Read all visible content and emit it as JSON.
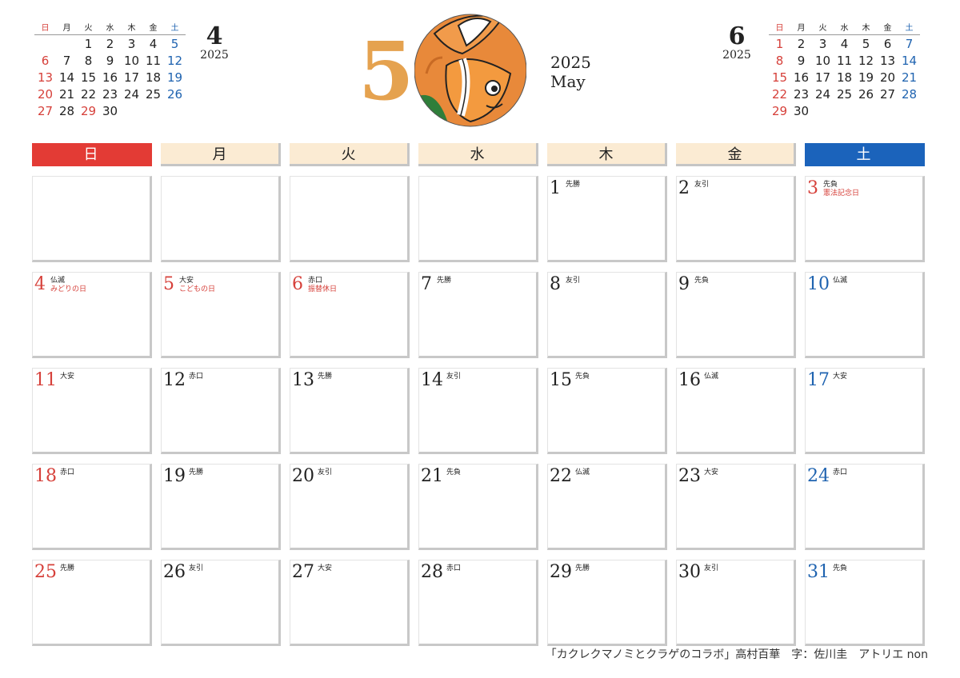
{
  "weekday_labels": [
    "日",
    "月",
    "火",
    "水",
    "木",
    "金",
    "土"
  ],
  "prev_month": {
    "month": "4",
    "year": "2025",
    "days": [
      "",
      "",
      "1",
      "2",
      "3",
      "4",
      "5",
      "6",
      "7",
      "8",
      "9",
      "10",
      "11",
      "12",
      "13",
      "14",
      "15",
      "16",
      "17",
      "18",
      "19",
      "20",
      "21",
      "22",
      "23",
      "24",
      "25",
      "26",
      "27",
      "28",
      "29",
      "30",
      "",
      "",
      ""
    ],
    "holidays": [
      "29"
    ]
  },
  "next_month": {
    "month": "6",
    "year": "2025",
    "days": [
      "1",
      "2",
      "3",
      "4",
      "5",
      "6",
      "7",
      "8",
      "9",
      "10",
      "11",
      "12",
      "13",
      "14",
      "15",
      "16",
      "17",
      "18",
      "19",
      "20",
      "21",
      "22",
      "23",
      "24",
      "25",
      "26",
      "27",
      "28",
      "29",
      "30",
      "",
      "",
      "",
      "",
      ""
    ],
    "holidays": []
  },
  "current": {
    "month_number": "5",
    "year": "2025",
    "month_name": "May"
  },
  "days": [
    {
      "num": "",
      "rokuyo": "",
      "holiday": ""
    },
    {
      "num": "",
      "rokuyo": "",
      "holiday": ""
    },
    {
      "num": "",
      "rokuyo": "",
      "holiday": ""
    },
    {
      "num": "",
      "rokuyo": "",
      "holiday": ""
    },
    {
      "num": "1",
      "rokuyo": "先勝",
      "holiday": ""
    },
    {
      "num": "2",
      "rokuyo": "友引",
      "holiday": ""
    },
    {
      "num": "3",
      "rokuyo": "先負",
      "holiday": "憲法記念日"
    },
    {
      "num": "4",
      "rokuyo": "仏滅",
      "holiday": "みどりの日"
    },
    {
      "num": "5",
      "rokuyo": "大安",
      "holiday": "こどもの日"
    },
    {
      "num": "6",
      "rokuyo": "赤口",
      "holiday": "振替休日"
    },
    {
      "num": "7",
      "rokuyo": "先勝",
      "holiday": ""
    },
    {
      "num": "8",
      "rokuyo": "友引",
      "holiday": ""
    },
    {
      "num": "9",
      "rokuyo": "先負",
      "holiday": ""
    },
    {
      "num": "10",
      "rokuyo": "仏滅",
      "holiday": ""
    },
    {
      "num": "11",
      "rokuyo": "大安",
      "holiday": ""
    },
    {
      "num": "12",
      "rokuyo": "赤口",
      "holiday": ""
    },
    {
      "num": "13",
      "rokuyo": "先勝",
      "holiday": ""
    },
    {
      "num": "14",
      "rokuyo": "友引",
      "holiday": ""
    },
    {
      "num": "15",
      "rokuyo": "先負",
      "holiday": ""
    },
    {
      "num": "16",
      "rokuyo": "仏滅",
      "holiday": ""
    },
    {
      "num": "17",
      "rokuyo": "大安",
      "holiday": ""
    },
    {
      "num": "18",
      "rokuyo": "赤口",
      "holiday": ""
    },
    {
      "num": "19",
      "rokuyo": "先勝",
      "holiday": ""
    },
    {
      "num": "20",
      "rokuyo": "友引",
      "holiday": ""
    },
    {
      "num": "21",
      "rokuyo": "先負",
      "holiday": ""
    },
    {
      "num": "22",
      "rokuyo": "仏滅",
      "holiday": ""
    },
    {
      "num": "23",
      "rokuyo": "大安",
      "holiday": ""
    },
    {
      "num": "24",
      "rokuyo": "赤口",
      "holiday": ""
    },
    {
      "num": "25",
      "rokuyo": "先勝",
      "holiday": ""
    },
    {
      "num": "26",
      "rokuyo": "友引",
      "holiday": ""
    },
    {
      "num": "27",
      "rokuyo": "大安",
      "holiday": ""
    },
    {
      "num": "28",
      "rokuyo": "赤口",
      "holiday": ""
    },
    {
      "num": "29",
      "rokuyo": "先勝",
      "holiday": ""
    },
    {
      "num": "30",
      "rokuyo": "友引",
      "holiday": ""
    },
    {
      "num": "31",
      "rokuyo": "先負",
      "holiday": ""
    }
  ],
  "credit": "「カクレクマノミとクラゲのコラボ」高村百華　字：佐川圭　アトリエ non",
  "colors": {
    "sunday": "#d6403a",
    "saturday": "#1f63b0",
    "month_accent": "#e5a24f",
    "weekday_header_bg": "#fbebd3"
  },
  "illustration": "clownfish-illustration"
}
